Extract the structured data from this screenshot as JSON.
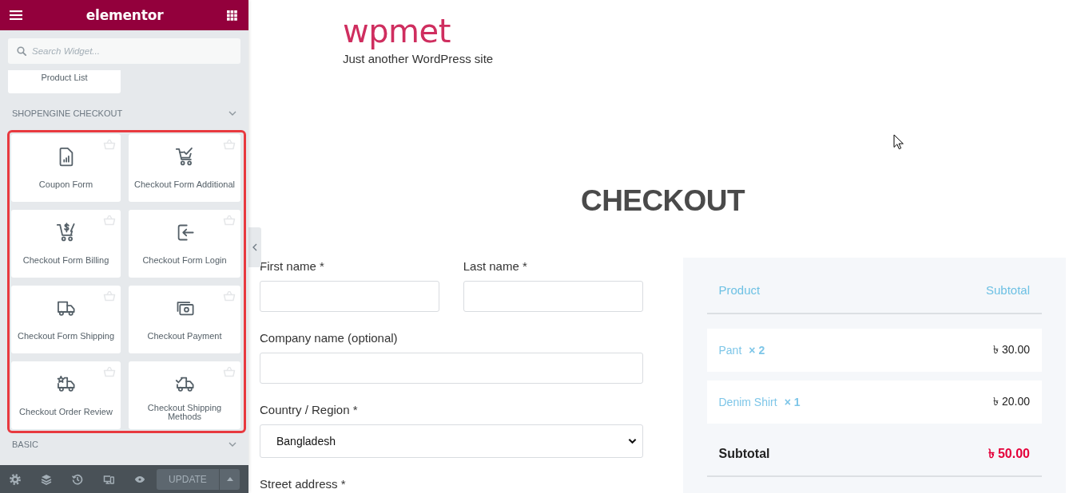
{
  "editor_panel": {
    "title": "elementor",
    "search": {
      "placeholder": "Search Widget..."
    },
    "partial_widget": {
      "label": "Product List"
    },
    "sections": [
      {
        "title": "SHOPENGINE CHECKOUT",
        "highlighted": true,
        "widgets": [
          {
            "kind": "coupon",
            "label": "Coupon Form"
          },
          {
            "kind": "additional",
            "label": "Checkout Form Additional"
          },
          {
            "kind": "billing",
            "label": "Checkout Form Billing"
          },
          {
            "kind": "login",
            "label": "Checkout Form Login"
          },
          {
            "kind": "shipping",
            "label": "Checkout Form Shipping"
          },
          {
            "kind": "payment",
            "label": "Checkout Payment"
          },
          {
            "kind": "review",
            "label": "Checkout Order Review"
          },
          {
            "kind": "methods",
            "label": "Checkout Shipping Methods"
          }
        ]
      },
      {
        "title": "BASIC"
      }
    ],
    "footer": {
      "update_button": {
        "label": "UPDATE",
        "disabled": true
      }
    }
  },
  "page": {
    "site_title": "wpmet",
    "tagline": "Just another WordPress site",
    "heading": "CHECKOUT",
    "billing_form": {
      "rows": [
        [
          {
            "label": "First name *",
            "input": {
              "kind": "text"
            }
          },
          {
            "label": "Last name *",
            "input": {
              "kind": "text"
            }
          }
        ],
        [
          {
            "label": "Company name (optional)",
            "input": {
              "kind": "text"
            }
          }
        ],
        [
          {
            "label": "Country / Region *",
            "input": {
              "kind": "select",
              "value": "Bangladesh"
            }
          }
        ],
        [
          {
            "label": "Street address *"
          }
        ]
      ]
    },
    "order_review": {
      "columns": [
        "Product",
        "Subtotal"
      ],
      "items": [
        {
          "name": "Pant",
          "quantity": "× 2",
          "price": "৳ 30.00"
        },
        {
          "name": "Denim Shirt",
          "quantity": "× 1",
          "price": "৳ 20.00"
        }
      ],
      "subtotal": {
        "label": "Subtotal",
        "value": "৳ 50.00"
      }
    }
  }
}
